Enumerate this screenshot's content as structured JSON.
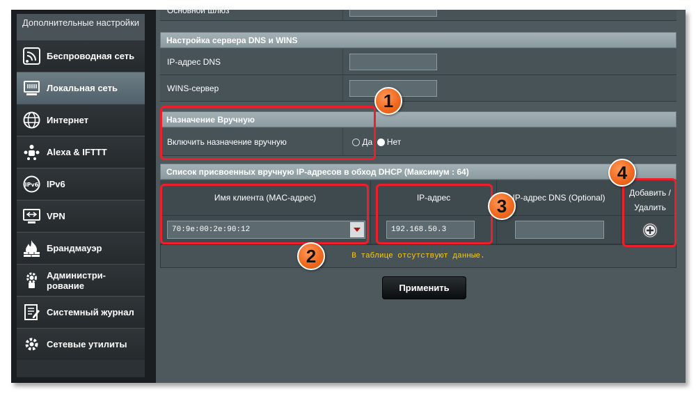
{
  "sidebar": {
    "header": "Дополнительные настройки",
    "items": [
      {
        "label": "Беспроводная сеть",
        "icon": "wifi-icon"
      },
      {
        "label": "Локальная сеть",
        "icon": "lan-icon"
      },
      {
        "label": "Интернет",
        "icon": "globe-icon"
      },
      {
        "label": "Alexa & IFTTT",
        "icon": "alexa-icon"
      },
      {
        "label": "IPv6",
        "icon": "ipv6-icon"
      },
      {
        "label": "VPN",
        "icon": "vpn-icon"
      },
      {
        "label": "Брандмауэр",
        "icon": "firewall-icon"
      },
      {
        "label": "Администри-\nрование",
        "icon": "admin-gear-icon"
      },
      {
        "label": "Системный журнал",
        "icon": "log-icon"
      },
      {
        "label": "Сетевые утилиты",
        "icon": "tools-icon"
      }
    ],
    "active_index": 1
  },
  "gateway": {
    "label": "Основной шлюз"
  },
  "dns_section": {
    "title": "Настройка сервера DNS и WINS",
    "dns_label": "IP-адрес DNS",
    "wins_label": "WINS-сервер"
  },
  "manual": {
    "title": "Назначение Вручную",
    "enable_label": "Включить назначение вручную",
    "yes": "Да",
    "no": "Нет",
    "selected": "Нет"
  },
  "list": {
    "title": "Список присвоенных вручную IP-адресов в обход DHCP (Максимум : 64)",
    "col_client": "Имя клиента (MAC-адрес)",
    "col_ip": "IP-адрес",
    "col_dns": "IP-адрес DNS (Optional)",
    "col_action": "Добавить / Удалить",
    "mac_value": "70:9e:00:2e:90:12",
    "ip_value": "192.168.50.3",
    "empty_text": "В таблице отсутствуют данные."
  },
  "apply_label": "Применить",
  "badges": [
    "1",
    "2",
    "3",
    "4"
  ],
  "colors": {
    "highlight": "#ee1f2a",
    "badge": "#f06a20",
    "empty_text": "#ffcc00"
  }
}
